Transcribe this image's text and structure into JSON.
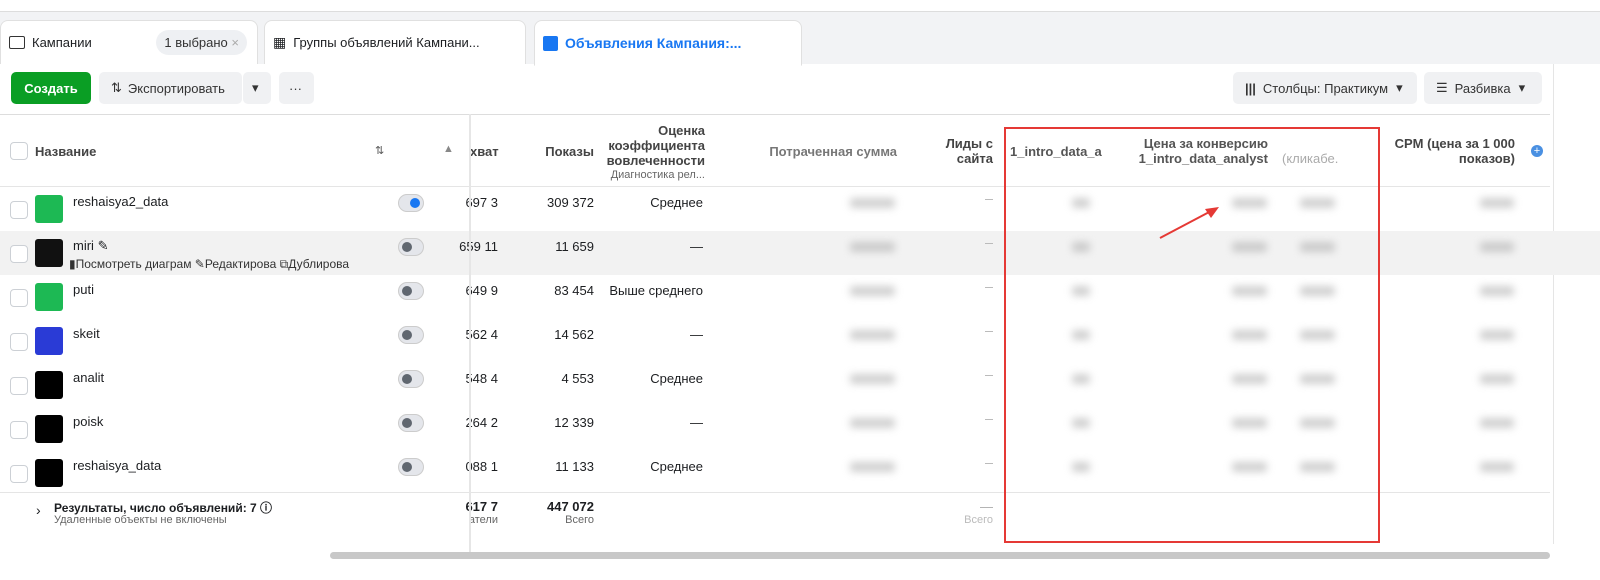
{
  "tabs": [
    {
      "label": "Кампании",
      "badge": "1 выбрано",
      "icon": "folder-icon"
    },
    {
      "label": "Группы объявлений Кампани...",
      "icon": "grid-icon"
    },
    {
      "label": "Объявления Кампания:...",
      "icon": "ad-icon",
      "active": true
    }
  ],
  "toolbar": {
    "create": "Создать",
    "export": "Экспортировать",
    "more": "···",
    "columns": "Столбцы: Практикум",
    "breakdown": "Разбивка"
  },
  "columns": {
    "name": "Название",
    "reach": "хват",
    "impressions": "Показы",
    "engagement": "Оценка коэффициента вовлеченности",
    "engagement_sub": "Диагностика рел...",
    "spent": "Потраченная сумма",
    "leads": "Лиды с сайта",
    "intro": "1_intro_data_a",
    "cpa": "Цена за конверсию 1_intro_data_analyst",
    "ctr": "(кликабе.",
    "cpm": "CPM (цена за 1 000 показов)"
  },
  "rows": [
    {
      "name": "reshaisya2_data",
      "reach": "3 697",
      "impressions": "309 372",
      "engagement": "Среднее",
      "active": true,
      "thumb": "#1db954"
    },
    {
      "name": "miri",
      "reach": "11 659",
      "impressions": "11 659",
      "engagement": "—",
      "active": false,
      "thumb": "#111",
      "hover": true
    },
    {
      "name": "puti",
      "reach": "9 649",
      "impressions": "83 454",
      "engagement": "Выше среднего",
      "active": false,
      "thumb": "#1db954"
    },
    {
      "name": "skeit",
      "reach": "4 562",
      "impressions": "14 562",
      "engagement": "—",
      "active": false,
      "thumb": "#2a3bd6"
    },
    {
      "name": "analit",
      "reach": "4 548",
      "impressions": "4 553",
      "engagement": "Среднее",
      "active": false,
      "thumb": "#000"
    },
    {
      "name": "poisk",
      "reach": "2 264",
      "impressions": "12 339",
      "engagement": "—",
      "active": false,
      "thumb": "#000"
    },
    {
      "name": "reshaisya_data",
      "reach": "1 088",
      "impressions": "11 133",
      "engagement": "Среднее",
      "active": false,
      "thumb": "#000"
    }
  ],
  "row_actions": {
    "chart": "Посмотреть диаграм",
    "edit": "Редактирова",
    "duplicate": "Дублирова"
  },
  "footer": {
    "title": "Результаты, число объявлений: 7",
    "note": "Удаленные объекты не включены",
    "reach": "7 617",
    "reach_sub": "атели",
    "impressions": "447 072",
    "impressions_sub": "Всего",
    "leads": "—",
    "leads_sub": "Всего"
  },
  "colors": {
    "accent": "#1877f2",
    "create": "#0a9e24",
    "highlight": "#e53935"
  }
}
